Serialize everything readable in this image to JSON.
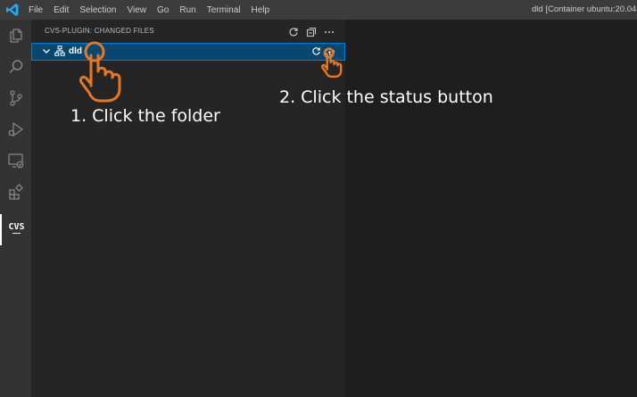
{
  "titlebar": {
    "menu": [
      "File",
      "Edit",
      "Selection",
      "View",
      "Go",
      "Run",
      "Terminal",
      "Help"
    ],
    "window_title": "dld [Container ubuntu:20.04 ("
  },
  "activity_bar": {
    "items": [
      "explorer-icon",
      "search-icon",
      "source-control-icon",
      "run-debug-icon",
      "remote-explorer-icon",
      "extensions-icon",
      "cvs-plugin-icon"
    ],
    "active_item": "cvs-plugin-icon"
  },
  "sidebar": {
    "panel_title": "CVS-PLUGIN: CHANGED FILES",
    "header_actions": [
      "refresh-icon",
      "collapse-all-icon",
      "more-actions-icon"
    ],
    "tree": {
      "folder_label": "dld",
      "expanded": true,
      "row_actions": [
        "refresh-icon",
        "cloud-status-icon"
      ]
    }
  },
  "annotations": {
    "step1": "1. Click the folder",
    "step2": "2. Click the status button"
  },
  "colors": {
    "accent": "#007fd4",
    "selection": "#094771",
    "hand": "#e87722",
    "sidebar_bg": "#252526",
    "editor_bg": "#1e1e1e",
    "activity_bar_bg": "#333333",
    "titlebar_bg": "#3c3c3c",
    "vscode_logo": "#23a9f2"
  }
}
